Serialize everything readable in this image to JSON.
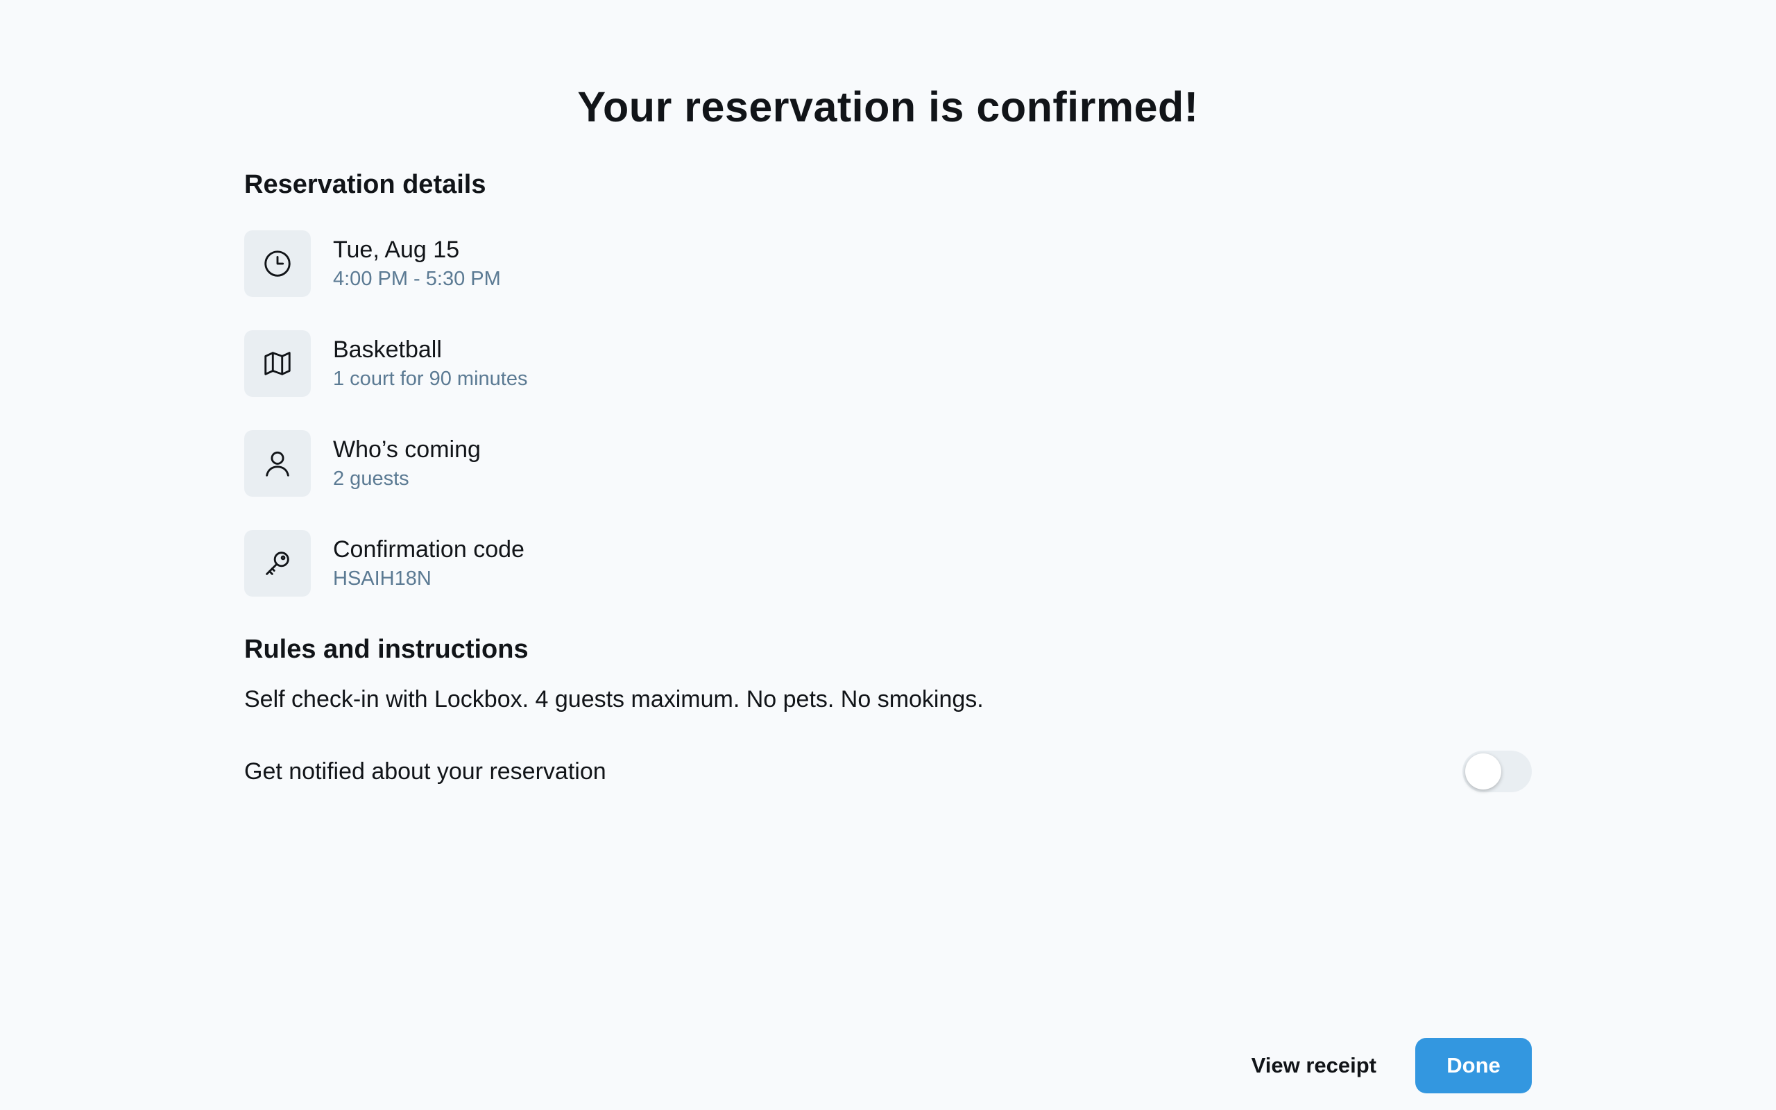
{
  "page": {
    "title": "Your reservation is confirmed!"
  },
  "details": {
    "heading": "Reservation details",
    "items": [
      {
        "icon": "clock-icon",
        "title": "Tue, Aug 15",
        "subtitle": "4:00 PM - 5:30 PM"
      },
      {
        "icon": "map-icon",
        "title": "Basketball",
        "subtitle": "1 court for 90 minutes"
      },
      {
        "icon": "user-icon",
        "title": "Who’s coming",
        "subtitle": "2 guests"
      },
      {
        "icon": "key-icon",
        "title": "Confirmation code",
        "subtitle": "HSAIH18N"
      }
    ]
  },
  "rules": {
    "heading": "Rules and instructions",
    "text": "Self check-in with Lockbox. 4 guests maximum. No pets. No smokings."
  },
  "notifications": {
    "label": "Get notified about your reservation",
    "enabled": false
  },
  "actions": {
    "view_receipt_label": "View receipt",
    "done_label": "Done"
  },
  "colors": {
    "background": "#f8fafc",
    "icon_tile": "#e9eef2",
    "subtitle": "#5b7a93",
    "primary": "#3397e0",
    "text": "#111418"
  }
}
